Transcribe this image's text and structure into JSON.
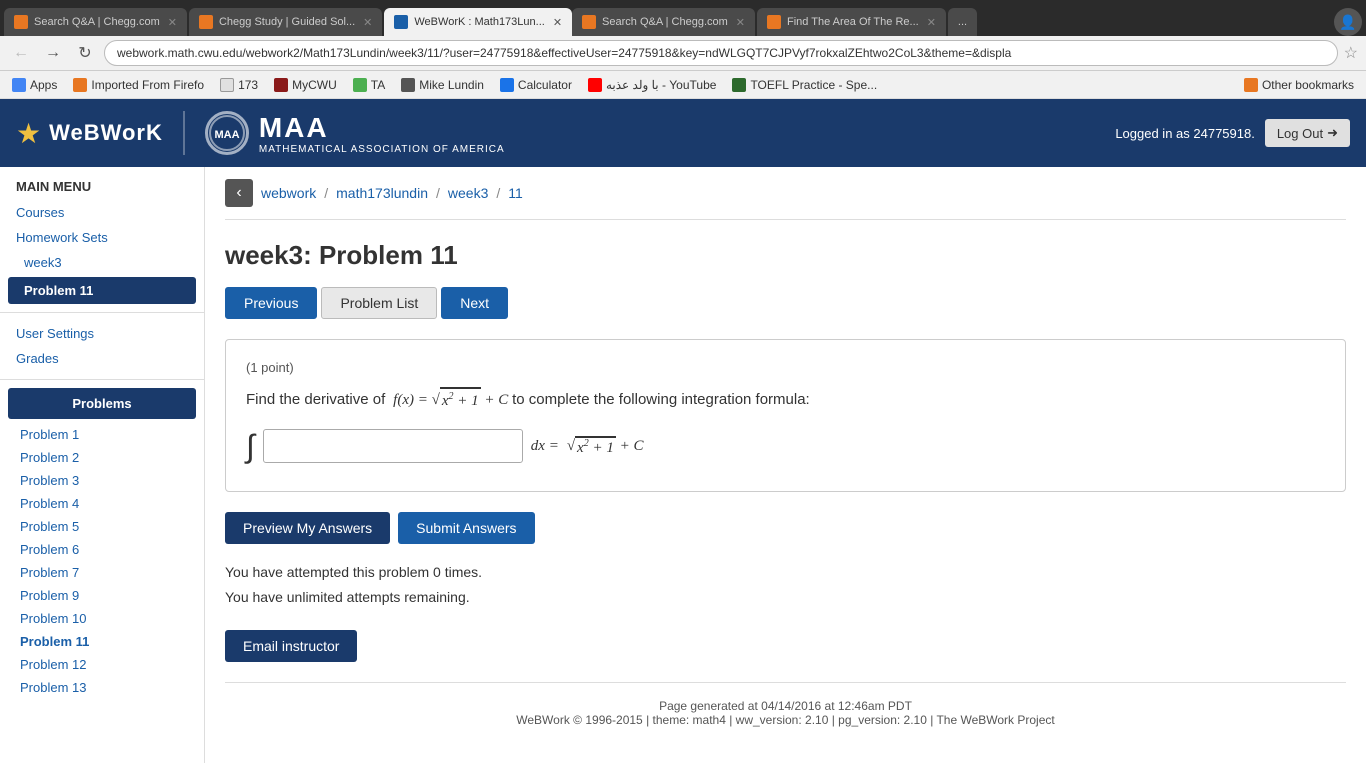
{
  "browser": {
    "tabs": [
      {
        "id": "tab1",
        "title": "Search Q&A | Chegg.com",
        "favicon_color": "#e87722",
        "active": false
      },
      {
        "id": "tab2",
        "title": "Chegg Study | Guided Sol...",
        "favicon_color": "#e87722",
        "active": false
      },
      {
        "id": "tab3",
        "title": "WeBWorK : Math173Lun...",
        "favicon_color": "#1a5fa8",
        "active": true
      },
      {
        "id": "tab4",
        "title": "Search Q&A | Chegg.com",
        "favicon_color": "#e87722",
        "active": false
      },
      {
        "id": "tab5",
        "title": "Find The Area Of The Re...",
        "favicon_color": "#e87722",
        "active": false
      },
      {
        "id": "tab6",
        "title": "...",
        "favicon_color": "#555",
        "active": false
      }
    ],
    "url": "webwork.math.cwu.edu/webwork2/Math173Lundin/week3/11/?user=24775918&effectiveUser=24775918&key=ndWLGQT7CJPVyf7rokxalZEhtwo2CoL3&theme=&displa",
    "bookmarks": [
      {
        "label": "Apps",
        "icon_color": "#4285f4"
      },
      {
        "label": "Imported From Firefo",
        "icon_color": "#e87722"
      },
      {
        "label": "173",
        "icon_color": "#e0e0e0"
      },
      {
        "label": "MyCWU",
        "icon_color": "#8b1a1a"
      },
      {
        "label": "TA",
        "icon_color": "#4caf50"
      },
      {
        "label": "Mike Lundin",
        "icon_color": "#555"
      },
      {
        "label": "Calculator",
        "icon_color": "#1a73e8"
      },
      {
        "label": "با ولد عذبه - YouTube",
        "icon_color": "#ff0000"
      },
      {
        "label": "TOEFL Practice - Spe...",
        "icon_color": "#2d6a2d"
      },
      {
        "label": "Other bookmarks",
        "icon_color": "#e87722"
      }
    ]
  },
  "header": {
    "logo_text": "WeBWorK",
    "maa_full": "MAA",
    "maa_subtitle": "MATHEMATICAL ASSOCIATION OF AMERICA",
    "logged_in_text": "Logged in as 24775918.",
    "logout_label": "Log Out"
  },
  "sidebar": {
    "main_menu": "MAIN MENU",
    "courses_label": "Courses",
    "homework_sets_label": "Homework Sets",
    "week3_label": "week3",
    "problem11_label": "Problem 11",
    "user_settings_label": "User Settings",
    "grades_label": "Grades",
    "problems_header": "Problems",
    "problem_links": [
      "Problem 1",
      "Problem 2",
      "Problem 3",
      "Problem 4",
      "Problem 5",
      "Problem 6",
      "Problem 7",
      "Problem 9",
      "Problem 10",
      "Problem 11",
      "Problem 12",
      "Problem 13"
    ]
  },
  "breadcrumb": {
    "parts": [
      "webwork",
      "math173lundin",
      "week3",
      "11"
    ]
  },
  "content": {
    "title": "week3: Problem 11",
    "prev_label": "Previous",
    "list_label": "Problem List",
    "next_label": "Next",
    "point_value": "(1 point)",
    "problem_intro": "Find the derivative of",
    "problem_math_desc": "f(x) = √(x² + 1) + C",
    "problem_suffix": "to complete the following integration formula:",
    "integral_symbol": "∫",
    "dx_text": "dx =",
    "result_math": "√(x² + 1) + C",
    "preview_label": "Preview My Answers",
    "submit_label": "Submit Answers",
    "attempt_line1": "You have attempted this problem 0 times.",
    "attempt_line2": "You have unlimited attempts remaining.",
    "email_label": "Email instructor",
    "footer_text": "Page generated at 04/14/2016 at 12:46am PDT",
    "footer_sub": "WeBWork © 1996-2015 | theme: math4 | ww_version: 2.10 | pg_version: 2.10 | The WeBWork Project"
  }
}
